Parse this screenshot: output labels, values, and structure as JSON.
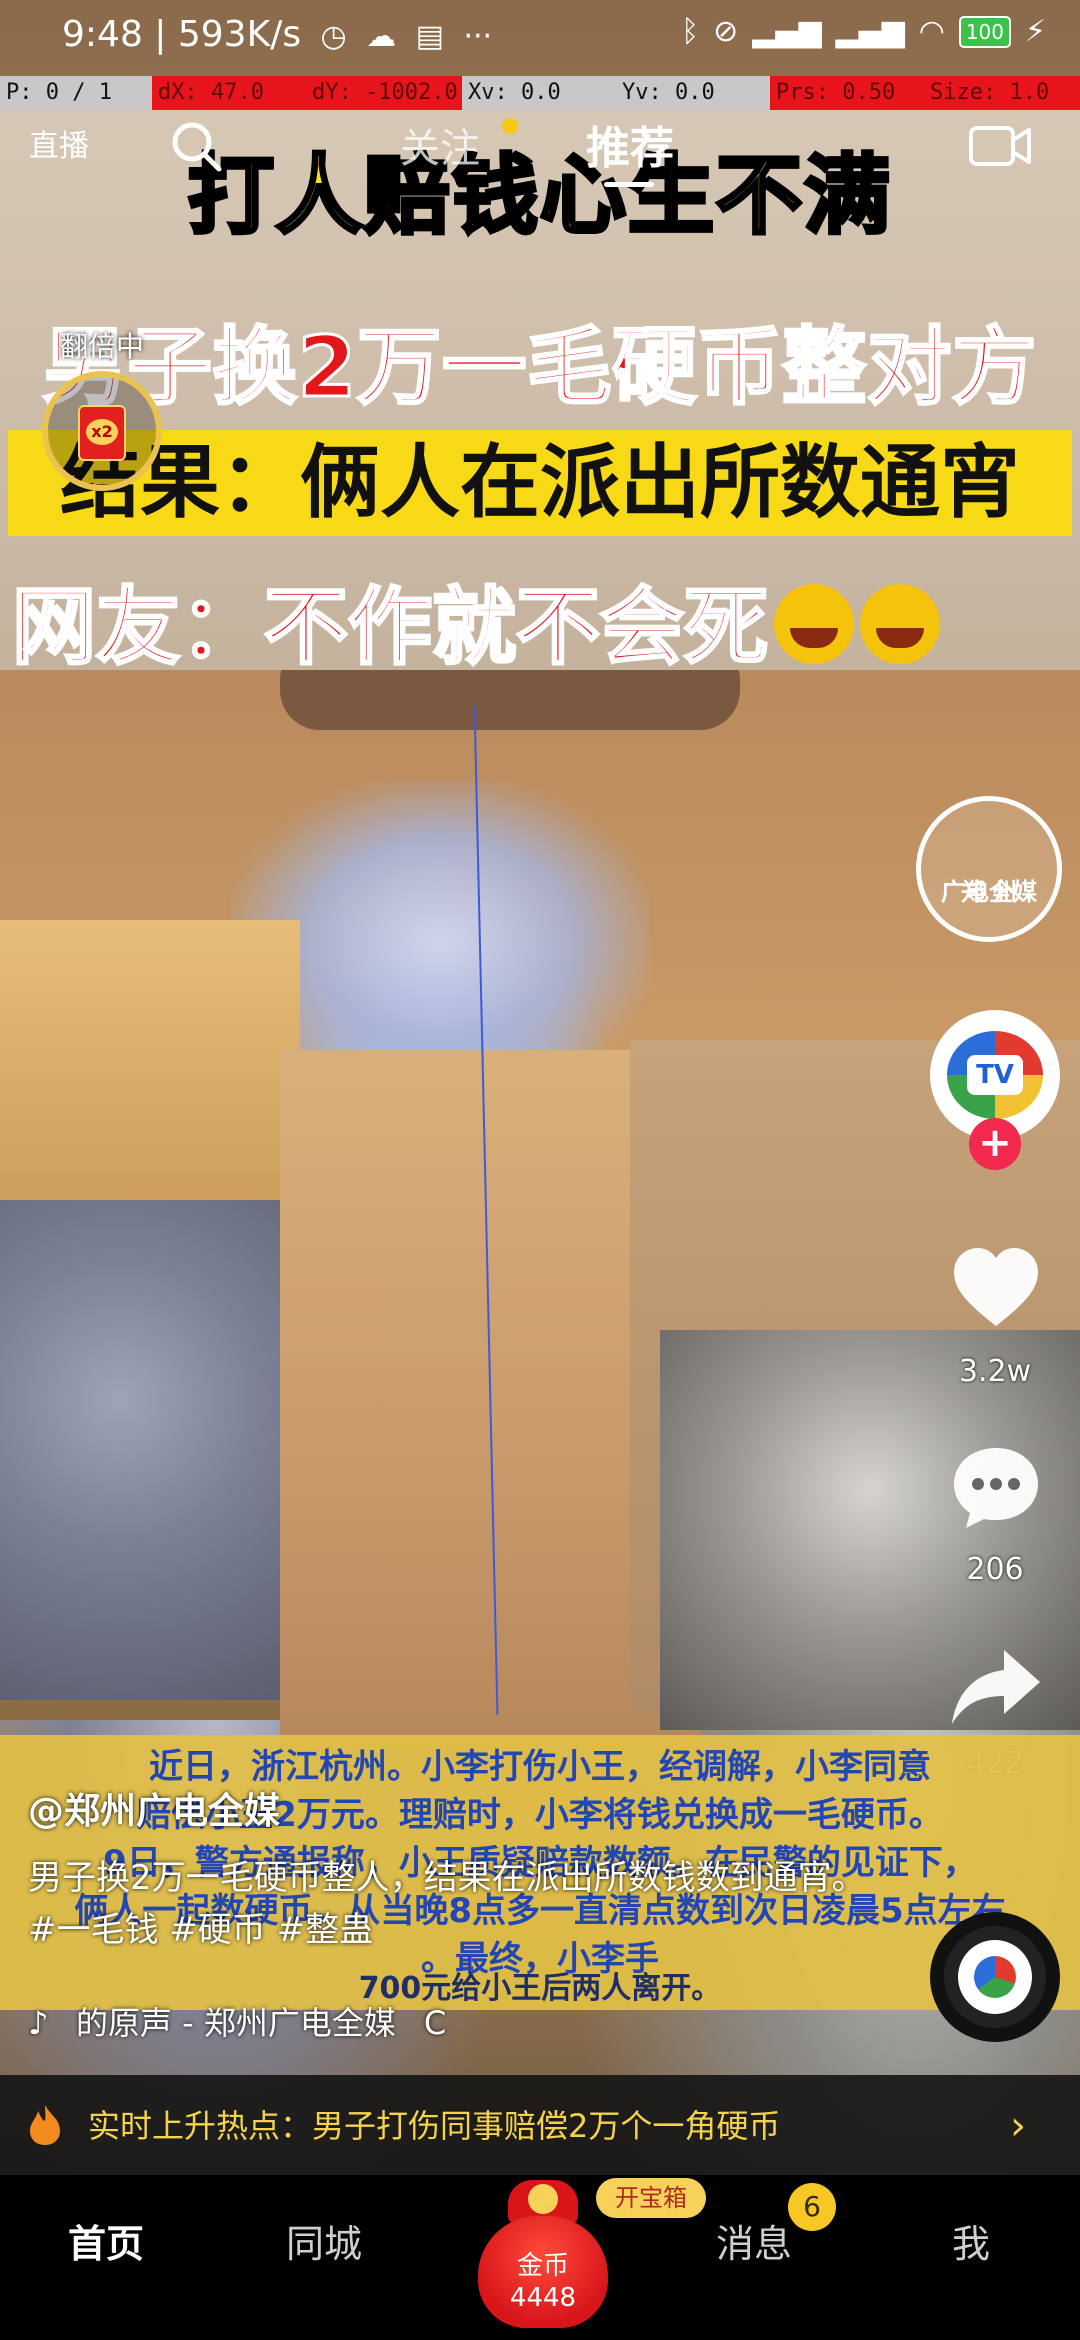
{
  "status_bar": {
    "time": "9:48",
    "speed": "593K/s",
    "icons": [
      "alarm-icon",
      "wechat-icon",
      "message-icon",
      "more-icon",
      "bluetooth-icon",
      "nfc-icon",
      "signal-icon",
      "wifi-icon",
      "battery-icon",
      "charging-icon"
    ],
    "battery": "100"
  },
  "debug_bar": {
    "p": "P: 0 / 1",
    "dx": "dX: 47.0",
    "dy": "dY: -1002.0",
    "xv": "Xv: 0.0",
    "yv": "Yv: 0.0",
    "prs": "Prs: 0.50",
    "size": "Size: 1.0"
  },
  "top_nav": {
    "live": "直播",
    "follow": "关注",
    "recommend": "推荐"
  },
  "headline": {
    "line1": "打人赔钱心生不满",
    "line2": "男子换2万一毛硬币整对方",
    "line3": "结果：俩人在派出所数通宵",
    "line4": "网友：不作就不会死"
  },
  "double_widget": {
    "label": "翻倍中",
    "multiplier": "x2"
  },
  "creator_badge": {
    "line1": "郑 州",
    "line2": "广电全媒"
  },
  "avatar": {
    "text": "TV"
  },
  "actions": {
    "likes": "3.2w",
    "comments": "206",
    "shares": "422"
  },
  "caption_panel": {
    "text": "近日，浙江杭州。小李打伤小王，经调解，小李同意\n赔偿小王2万元。理赔时，小李将钱兑换成一毛硬币。\n9日，警方通报称，小王质疑赔款数额。在民警的见证下，\n俩人一起数硬币，从当晚8点多一直清点数到次日凌晨5点左右\n。最终，小李手",
    "tail": "700元给小王后两人离开。"
  },
  "post": {
    "author": "@郑州广电全媒",
    "description": "男子换2万一毛硬币整人，结果在派出所数钱数到通宵。#一毛钱 #硬币 #整蛊",
    "sound": "的原声 - 郑州广电全媒",
    "sound_extra": "C"
  },
  "trending": {
    "text": "实时上升热点：男子打伤同事赔偿2万个一角硬币"
  },
  "bottom_nav": {
    "home": "首页",
    "city": "同城",
    "treasure": "开宝箱",
    "coin_label": "金币",
    "coin_count": "4448",
    "messages": "消息",
    "message_badge": "6",
    "me": "我"
  },
  "colors": {
    "headline_yellow": "#f7e21c",
    "headline_red": "#e3161a",
    "caption_blue": "#2346b5",
    "trending_text": "#f3d34b",
    "like_white": "#ffffff",
    "follow_plus": "#f1294f"
  }
}
